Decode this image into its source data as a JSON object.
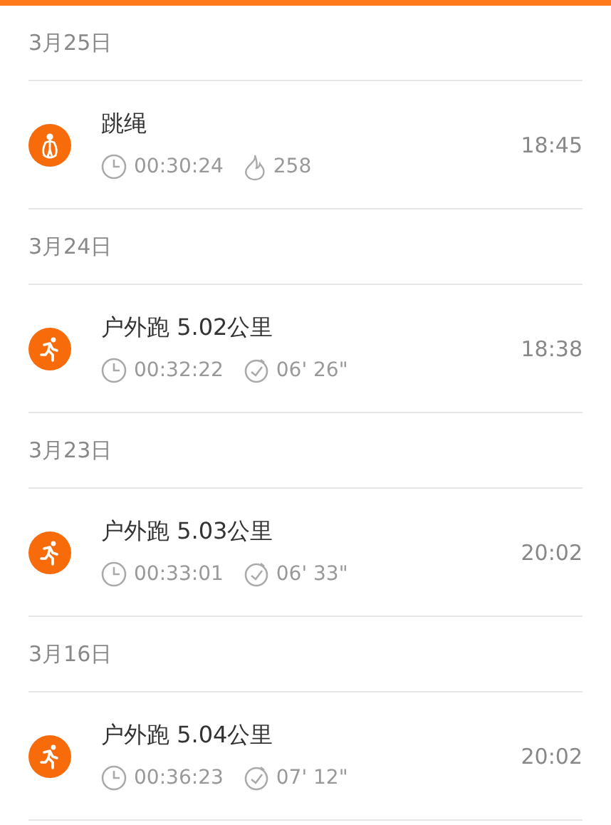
{
  "days": [
    {
      "date": "3月25日",
      "records": [
        {
          "kind": "jump_rope",
          "title": "跳绳",
          "stats": [
            {
              "kind": "duration",
              "value": "00:30:24"
            },
            {
              "kind": "calories",
              "value": "258"
            }
          ],
          "time": "18:45"
        }
      ]
    },
    {
      "date": "3月24日",
      "records": [
        {
          "kind": "run",
          "title": "户外跑 5.02公里",
          "stats": [
            {
              "kind": "duration",
              "value": "00:32:22"
            },
            {
              "kind": "pace",
              "value": "06' 26\""
            }
          ],
          "time": "18:38"
        }
      ]
    },
    {
      "date": "3月23日",
      "records": [
        {
          "kind": "run",
          "title": "户外跑 5.03公里",
          "stats": [
            {
              "kind": "duration",
              "value": "00:33:01"
            },
            {
              "kind": "pace",
              "value": "06' 33\""
            }
          ],
          "time": "20:02"
        }
      ]
    },
    {
      "date": "3月16日",
      "records": [
        {
          "kind": "run",
          "title": "户外跑 5.04公里",
          "stats": [
            {
              "kind": "duration",
              "value": "00:36:23"
            },
            {
              "kind": "pace",
              "value": "07' 12\""
            }
          ],
          "time": "20:02"
        }
      ]
    }
  ]
}
